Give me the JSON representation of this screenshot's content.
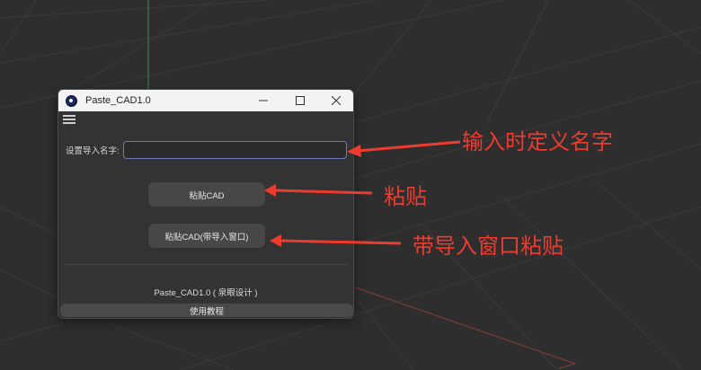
{
  "window": {
    "title": "Paste_CAD1.0",
    "icons": {
      "app": "cinema4d-app-icon",
      "menu": "hamburger-menu-icon",
      "minimize": "minimize-icon",
      "maximize": "maximize-icon",
      "close": "close-icon"
    }
  },
  "form": {
    "name_label": "设置导入名字:",
    "name_value": "",
    "paste_button": "粘贴CAD",
    "paste_window_button": "粘贴CAD(带导入窗口)",
    "footer": "Paste_CAD1.0 ( 泉眼设计 )",
    "tutorial_button": "使用教程"
  },
  "annotations": {
    "name_hint": "输入时定义名字",
    "paste_hint": "粘贴",
    "paste_window_hint": "带导入窗口粘贴",
    "color": "#ee3b2e"
  },
  "viewport": {
    "background": "#2e2e2e",
    "grid_color": "#3d3d3d"
  }
}
